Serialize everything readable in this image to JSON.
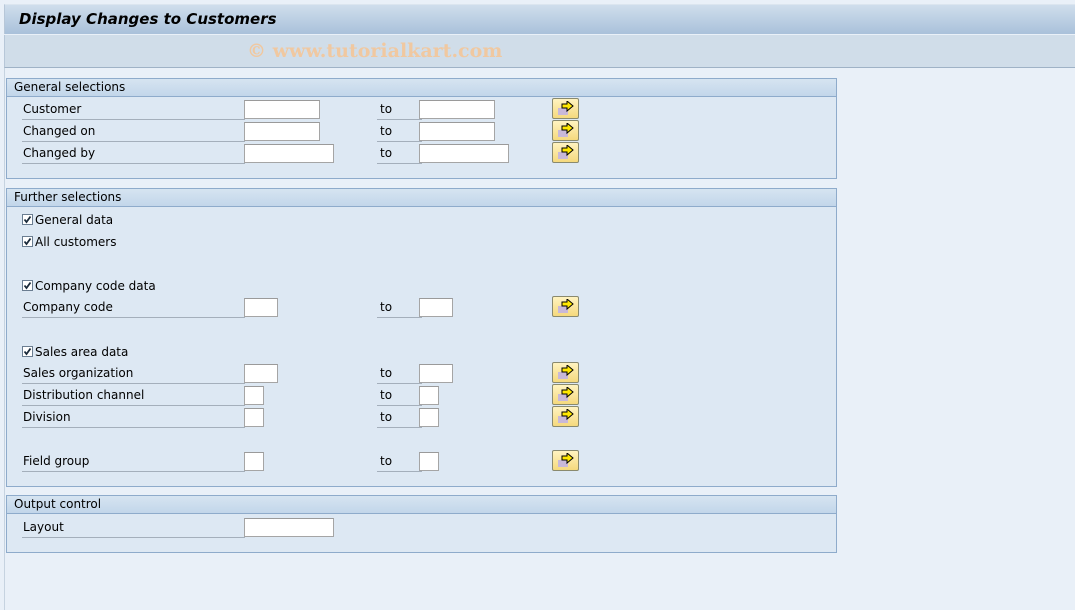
{
  "window": {
    "title": "Display Changes to Customers",
    "watermark": "© www.tutorialkart.com"
  },
  "general_selections": {
    "header": "General selections",
    "rows": [
      {
        "label": "Customer",
        "from_value": "",
        "to_label": "to",
        "to_value": ""
      },
      {
        "label": "Changed on",
        "from_value": "",
        "to_label": "to",
        "to_value": ""
      },
      {
        "label": "Changed by",
        "from_value": "",
        "to_label": "to",
        "to_value": ""
      }
    ]
  },
  "further_selections": {
    "header": "Further selections",
    "general_data": {
      "label": "General data",
      "checked": true
    },
    "all_customers": {
      "label": "All customers",
      "checked": true
    },
    "company_code_data": {
      "label": "Company code data",
      "checked": true
    },
    "company_code": {
      "label": "Company code",
      "from_value": "",
      "to_label": "to",
      "to_value": ""
    },
    "sales_area_data": {
      "label": "Sales area data",
      "checked": true
    },
    "sales_organization": {
      "label": "Sales organization",
      "from_value": "",
      "to_label": "to",
      "to_value": ""
    },
    "distribution_channel": {
      "label": "Distribution channel",
      "from_value": "",
      "to_label": "to",
      "to_value": ""
    },
    "division": {
      "label": "Division",
      "from_value": "",
      "to_label": "to",
      "to_value": ""
    },
    "field_group": {
      "label": "Field group",
      "from_value": "",
      "to_label": "to",
      "to_value": ""
    }
  },
  "output_control": {
    "header": "Output control",
    "layout": {
      "label": "Layout",
      "value": ""
    }
  },
  "icons": {
    "multiple_selection": "arrow-right-multiple-selection-icon",
    "checkbox_checked": "checkmark-icon"
  }
}
